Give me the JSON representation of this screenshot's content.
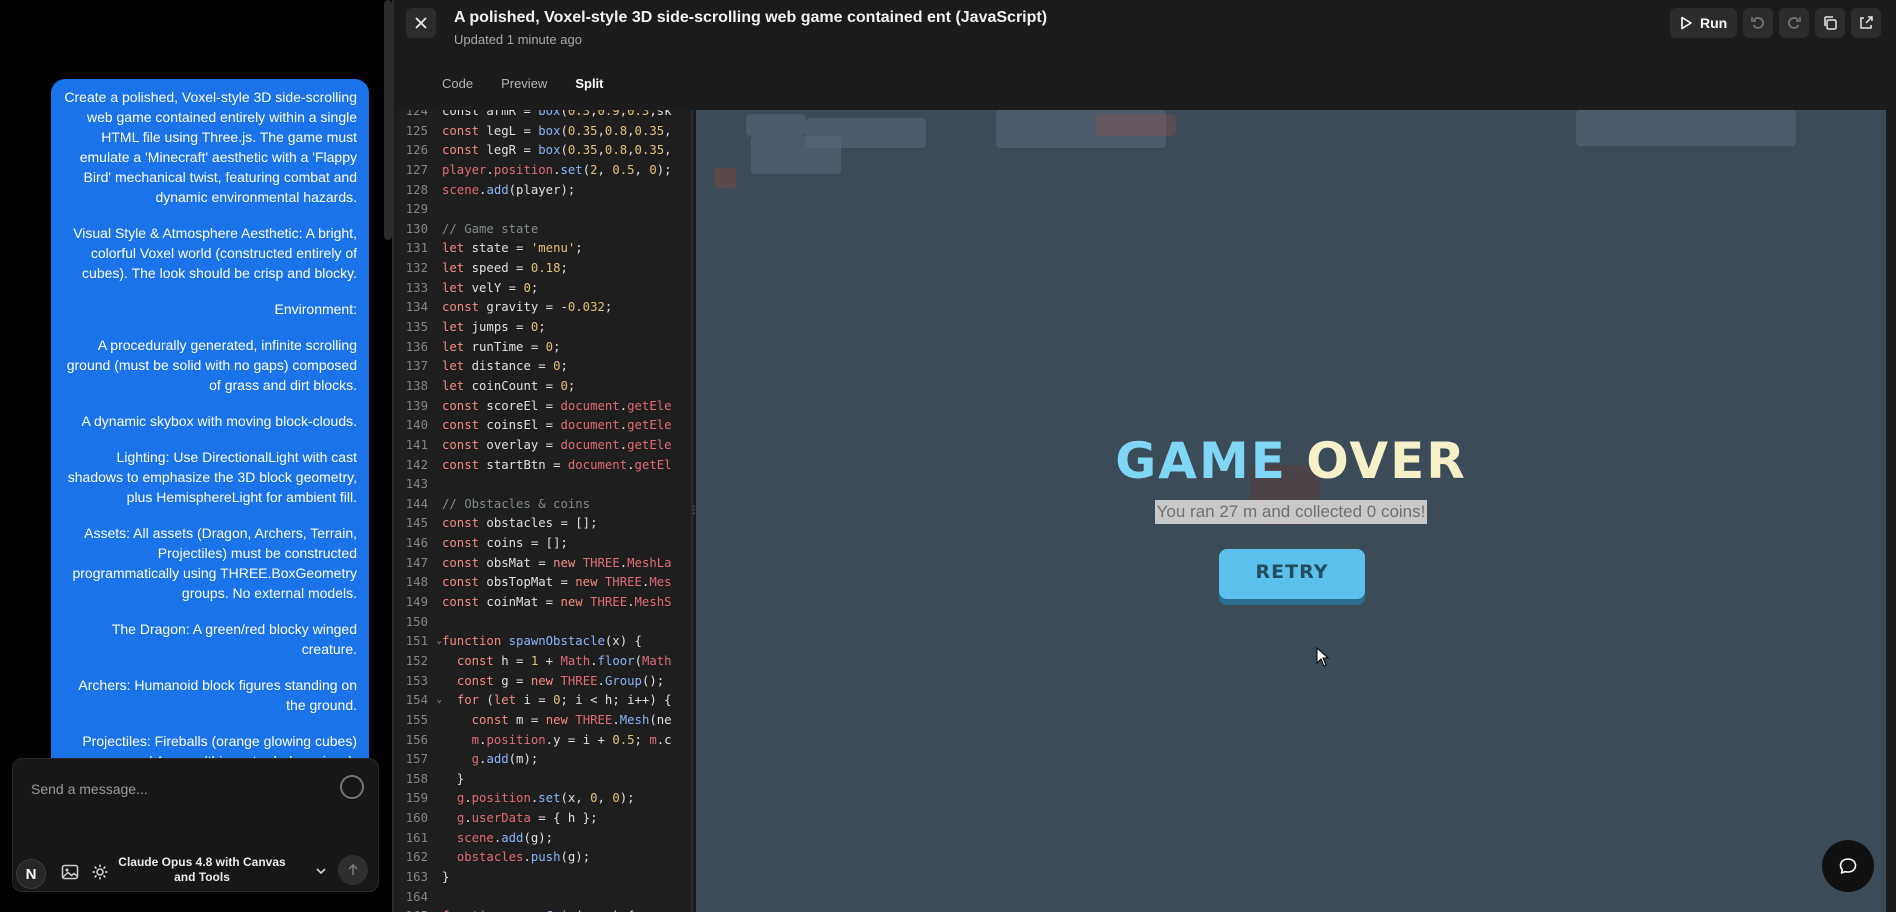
{
  "chat": {
    "prompt_paragraphs": [
      "Create a polished, Voxel-style 3D side-scrolling web game contained entirely within a single HTML file using Three.js. The game must emulate a 'Minecraft' aesthetic with a 'Flappy Bird' mechanical twist, featuring combat and dynamic environmental hazards.",
      "Visual Style & Atmosphere Aesthetic: A bright, colorful Voxel world (constructed entirely of cubes). The look should be crisp and blocky.",
      "Environment:",
      "A procedurally generated, infinite scrolling ground (must be solid with no gaps) composed of grass and dirt blocks.",
      "A dynamic skybox with moving block-clouds.",
      "Lighting: Use DirectionalLight with cast shadows to emphasize the 3D block geometry, plus HemisphereLight for ambient fill.",
      "Assets: All assets (Dragon, Archers, Terrain, Projectiles) must be constructed programmatically using THREE.BoxGeometry groups. No external models.",
      "The Dragon: A green/red blocky winged creature.",
      "Archers: Humanoid block figures standing on the ground.",
      "Projectiles: Fireballs (orange glowing cubes) and Arrows (thin, extruded versions)."
    ],
    "composer_placeholder": "Send a message...",
    "n_badge": "N",
    "model_label": "Claude Opus 4.8 with Canvas and Tools"
  },
  "artifact": {
    "title": "A polished, Voxel-style 3D side-scrolling web game contained ent (JavaScript)",
    "subtitle": "Updated 1 minute ago",
    "run_label": "Run",
    "tabs": [
      "Code",
      "Preview",
      "Split"
    ],
    "active_tab": "Split"
  },
  "code_lines": [
    {
      "n": "124",
      "fold": false,
      "html": "const armR = <span class='fn'>box</span>(<span class='num'>0.3</span>,<span class='num'>0.9</span>,<span class='num'>0.3</span>,sk"
    },
    {
      "n": "125",
      "fold": false,
      "html": "<span class='kw'>const</span> legL = <span class='fn'>box</span>(<span class='num'>0.35</span>,<span class='num'>0.8</span>,<span class='num'>0.35</span>,"
    },
    {
      "n": "126",
      "fold": false,
      "html": "<span class='kw'>const</span> legR = <span class='fn'>box</span>(<span class='num'>0.35</span>,<span class='num'>0.8</span>,<span class='num'>0.35</span>,"
    },
    {
      "n": "127",
      "fold": false,
      "html": "<span class='obj'>player</span>.<span class='obj'>position</span>.<span class='fn'>set</span>(<span class='num'>2</span>, <span class='num'>0.5</span>, <span class='num'>0</span>);"
    },
    {
      "n": "128",
      "fold": false,
      "html": "<span class='obj'>scene</span>.<span class='fn'>add</span>(player);"
    },
    {
      "n": "129",
      "fold": false,
      "html": ""
    },
    {
      "n": "130",
      "fold": false,
      "html": "<span class='cm'>// Game state</span>"
    },
    {
      "n": "131",
      "fold": false,
      "html": "<span class='kw'>let</span> state = <span class='str'>'menu'</span>;"
    },
    {
      "n": "132",
      "fold": false,
      "html": "<span class='kw'>let</span> speed = <span class='num'>0.18</span>;"
    },
    {
      "n": "133",
      "fold": false,
      "html": "<span class='kw'>let</span> velY = <span class='num'>0</span>;"
    },
    {
      "n": "134",
      "fold": false,
      "html": "<span class='kw'>const</span> gravity = -<span class='num'>0.032</span>;"
    },
    {
      "n": "135",
      "fold": false,
      "html": "<span class='kw'>let</span> jumps = <span class='num'>0</span>;"
    },
    {
      "n": "136",
      "fold": false,
      "html": "<span class='kw'>let</span> runTime = <span class='num'>0</span>;"
    },
    {
      "n": "137",
      "fold": false,
      "html": "<span class='kw'>let</span> distance = <span class='num'>0</span>;"
    },
    {
      "n": "138",
      "fold": false,
      "html": "<span class='kw'>let</span> coinCount = <span class='num'>0</span>;"
    },
    {
      "n": "139",
      "fold": false,
      "html": "<span class='kw'>const</span> scoreEl = <span class='obj'>document</span>.<span class='obj'>getEle</span>"
    },
    {
      "n": "140",
      "fold": false,
      "html": "<span class='kw'>const</span> coinsEl = <span class='obj'>document</span>.<span class='obj'>getEle</span>"
    },
    {
      "n": "141",
      "fold": false,
      "html": "<span class='kw'>const</span> overlay = <span class='obj'>document</span>.<span class='obj'>getEle</span>"
    },
    {
      "n": "142",
      "fold": false,
      "html": "<span class='kw'>const</span> startBtn = <span class='obj'>document</span>.<span class='obj'>getEl</span>"
    },
    {
      "n": "143",
      "fold": false,
      "html": ""
    },
    {
      "n": "144",
      "fold": false,
      "html": "<span class='cm'>// Obstacles &amp; coins</span>"
    },
    {
      "n": "145",
      "fold": false,
      "html": "<span class='kw'>const</span> obstacles = [];"
    },
    {
      "n": "146",
      "fold": false,
      "html": "<span class='kw'>const</span> coins = [];"
    },
    {
      "n": "147",
      "fold": false,
      "html": "<span class='kw'>const</span> obsMat = <span class='kw'>new</span> <span class='obj'>THREE</span>.<span class='obj'>MeshLa</span>"
    },
    {
      "n": "148",
      "fold": false,
      "html": "<span class='kw'>const</span> obsTopMat = <span class='kw'>new</span> <span class='obj'>THREE</span>.<span class='obj'>Mes</span>"
    },
    {
      "n": "149",
      "fold": false,
      "html": "<span class='kw'>const</span> coinMat = <span class='kw'>new</span> <span class='obj'>THREE</span>.<span class='obj'>MeshS</span>"
    },
    {
      "n": "150",
      "fold": false,
      "html": ""
    },
    {
      "n": "151",
      "fold": true,
      "html": "<span class='kw'>function</span> <span class='fn'>spawnObstacle</span>(x) {"
    },
    {
      "n": "152",
      "fold": false,
      "html": "  <span class='kw'>const</span> h = <span class='num'>1</span> + <span class='obj'>Math</span>.<span class='fn'>floor</span>(<span class='obj'>Math</span>"
    },
    {
      "n": "153",
      "fold": false,
      "html": "  <span class='kw'>const</span> g = <span class='kw'>new</span> <span class='obj'>THREE</span>.<span class='fn'>Group</span>();"
    },
    {
      "n": "154",
      "fold": true,
      "html": "  <span class='kw'>for</span> (<span class='kw'>let</span> i = <span class='num'>0</span>; i &lt; h; i++) {"
    },
    {
      "n": "155",
      "fold": false,
      "html": "    <span class='kw'>const</span> m = <span class='kw'>new</span> <span class='obj'>THREE</span>.<span class='fn'>Mesh</span>(ne"
    },
    {
      "n": "156",
      "fold": false,
      "html": "    <span class='obj'>m</span>.<span class='obj'>position</span>.y = i + <span class='num'>0.5</span>; <span class='obj'>m</span>.c"
    },
    {
      "n": "157",
      "fold": false,
      "html": "    <span class='obj'>g</span>.<span class='fn'>add</span>(m);"
    },
    {
      "n": "158",
      "fold": false,
      "html": "  }"
    },
    {
      "n": "159",
      "fold": false,
      "html": "  <span class='obj'>g</span>.<span class='obj'>position</span>.<span class='fn'>set</span>(x, <span class='num'>0</span>, <span class='num'>0</span>);"
    },
    {
      "n": "160",
      "fold": false,
      "html": "  <span class='obj'>g</span>.<span class='obj'>userData</span> = { h };"
    },
    {
      "n": "161",
      "fold": false,
      "html": "  <span class='obj'>scene</span>.<span class='fn'>add</span>(g);"
    },
    {
      "n": "162",
      "fold": false,
      "html": "  <span class='obj'>obstacles</span>.<span class='fn'>push</span>(g);"
    },
    {
      "n": "163",
      "fold": false,
      "html": "}"
    },
    {
      "n": "164",
      "fold": false,
      "html": ""
    },
    {
      "n": "165",
      "fold": false,
      "html": "<span class='kw'>function</span> <span class='fn'>spawnCoin</span>(x, y) {"
    }
  ],
  "game": {
    "title_part1": "GAME ",
    "title_part2": "OVER",
    "summary": "You ran 27 m and collected 0 coins!",
    "retry_label": "RETRY"
  },
  "colors": {
    "chat_bubble": "#1a73e8",
    "game_bg": "#3b4b58",
    "retry_button": "#5bc0ec",
    "title_cyan": "#7fd6f5",
    "title_cream": "#f5f0c8"
  }
}
